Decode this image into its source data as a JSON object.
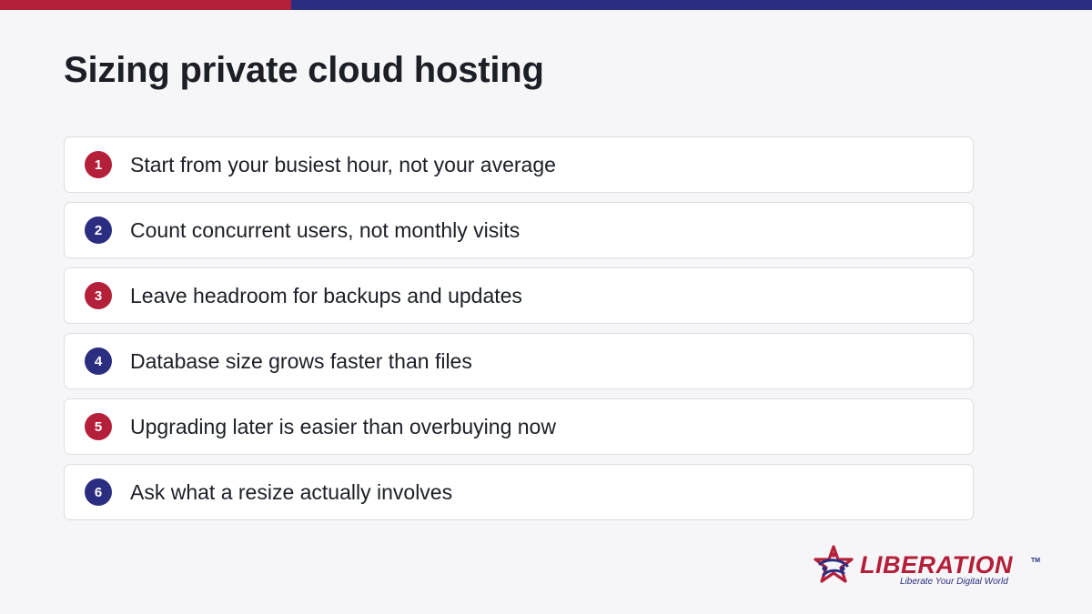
{
  "slide": {
    "title": "Sizing private cloud hosting",
    "items": [
      {
        "number": "1",
        "text": "Start from your busiest hour, not your average",
        "color": "#b41f39"
      },
      {
        "number": "2",
        "text": "Count concurrent users, not monthly visits",
        "color": "#2b2e80"
      },
      {
        "number": "3",
        "text": "Leave headroom for backups and updates",
        "color": "#b41f39"
      },
      {
        "number": "4",
        "text": "Database size grows faster than files",
        "color": "#2b2e80"
      },
      {
        "number": "5",
        "text": "Upgrading later is easier than overbuying now",
        "color": "#b41f39"
      },
      {
        "number": "6",
        "text": "Ask what a resize actually involves",
        "color": "#2b2e80"
      }
    ]
  },
  "brand": {
    "name": "LIBERATION",
    "tm": "TM",
    "tagline": "Liberate Your Digital World",
    "logo_icon": "star-logo-icon",
    "colors": {
      "red": "#b41f39",
      "blue": "#2b2e80"
    }
  }
}
